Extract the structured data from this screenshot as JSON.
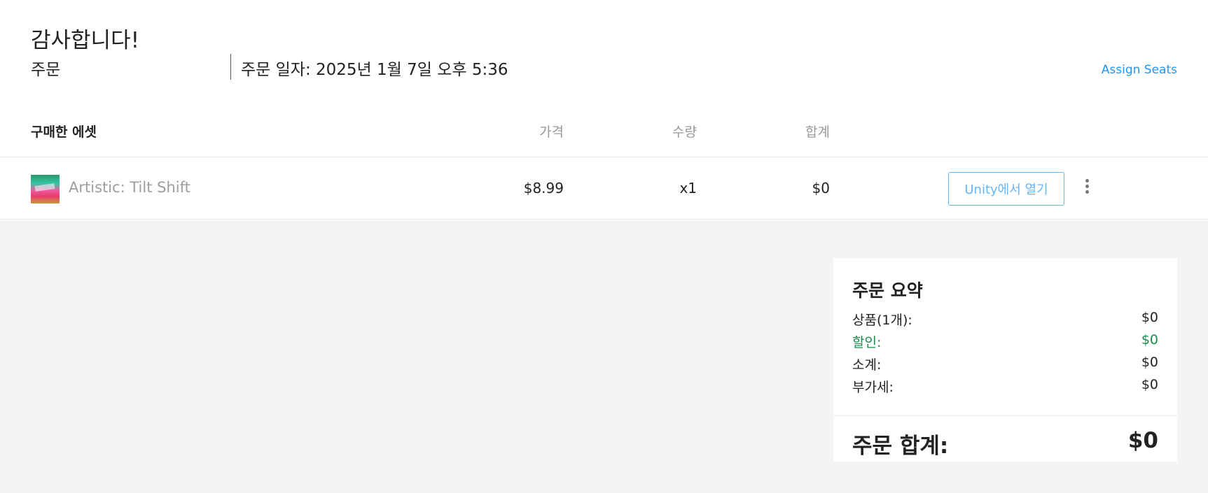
{
  "header": {
    "title": "감사합니다!",
    "order_label": "주문",
    "order_date": "주문 일자: 2025년 1월 7일 오후 5:36",
    "assign_seats": "Assign Seats"
  },
  "table": {
    "columns": {
      "assets": "구매한 에셋",
      "price": "가격",
      "quantity": "수량",
      "total": "합계"
    },
    "rows": [
      {
        "thumbnail_icon": "asset-thumbnail",
        "name": "Artistic: Tilt Shift",
        "price": "$8.99",
        "quantity": "x1",
        "total": "$0",
        "open_button": "Unity에서 열기",
        "more_icon": "kebab-menu-icon"
      }
    ]
  },
  "summary": {
    "title": "주문 요약",
    "lines": [
      {
        "label": "상품(1개):",
        "value": "$0"
      },
      {
        "label": "할인:",
        "value": "$0"
      },
      {
        "label": "소계:",
        "value": "$0"
      },
      {
        "label": "부가세:",
        "value": "$0"
      }
    ],
    "total_label": "주문 합계:",
    "total_value": "$0"
  },
  "colors": {
    "link": "#2196f3",
    "button_border": "#64b5f6",
    "discount": "#1e8a4c",
    "page_bg": "#f4f4f4"
  }
}
